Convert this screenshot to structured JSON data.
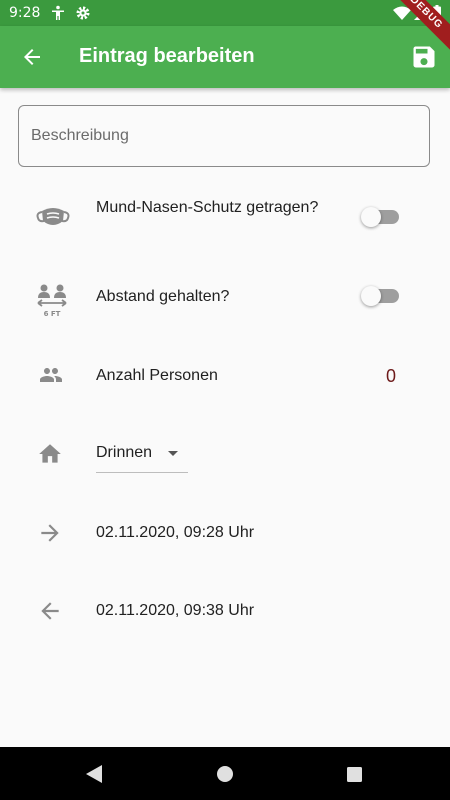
{
  "status_bar": {
    "time": "9:28"
  },
  "app_bar": {
    "title": "Eintrag bearbeiten",
    "debug_label": "DEBUG"
  },
  "form": {
    "description_placeholder": "Beschreibung",
    "description_value": "",
    "mask": {
      "label": "Mund-Nasen-Schutz getragen?",
      "checked": false
    },
    "distance": {
      "label": "Abstand gehalten?",
      "checked": false
    },
    "persons": {
      "label": "Anzahl Personen",
      "value": "0"
    },
    "location": {
      "selected": "Drinnen"
    },
    "arrival": {
      "value": "02.11.2020, 09:28 Uhr"
    },
    "departure": {
      "value": "02.11.2020, 09:38 Uhr"
    }
  },
  "colors": {
    "primary": "#4caf50",
    "status_bar": "#3b9a3e",
    "count_text": "#6d1a1a",
    "icon_grey": "#8a8a8a"
  }
}
